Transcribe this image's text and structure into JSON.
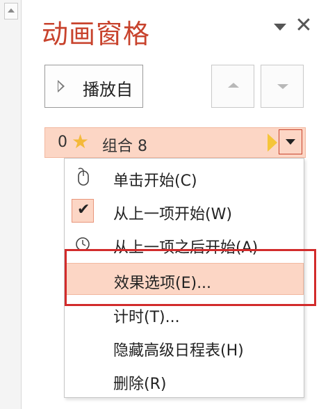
{
  "panel": {
    "title": "动画窗格",
    "play_button_label": "播放自"
  },
  "animation_item": {
    "order": "0",
    "name": "组合 8",
    "effect_icon": "star-icon",
    "accent_color": "#f4b93a"
  },
  "context_menu": {
    "items": [
      {
        "label": "单击开始(C)",
        "icon": "mouse-icon",
        "checked": false
      },
      {
        "label": "从上一项开始(W)",
        "icon": "checkmark-icon",
        "checked": true
      },
      {
        "label": "从上一项之后开始(A)",
        "icon": "clock-icon",
        "checked": false
      },
      {
        "label": "效果选项(E)...",
        "icon": "",
        "checked": false,
        "hovered": true
      },
      {
        "label": "计时(T)...",
        "icon": "",
        "checked": false
      },
      {
        "label": "隐藏高级日程表(H)",
        "icon": "",
        "checked": false
      },
      {
        "label": "删除(R)",
        "icon": "",
        "checked": false
      }
    ]
  },
  "colors": {
    "title": "#c8432d",
    "selection_fill": "#fcd6c5",
    "highlight_border": "#d22b2b"
  }
}
